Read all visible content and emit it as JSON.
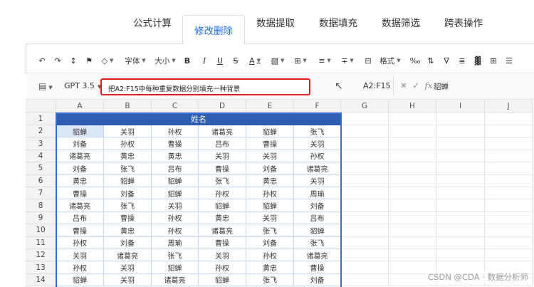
{
  "tabs": [
    "公式计算",
    "修改删除",
    "数据提取",
    "数据填充",
    "数据筛选",
    "跨表操作"
  ],
  "active_tab": 1,
  "toolbar": {
    "font_label": "字体",
    "size_label": "大小",
    "bold": "B",
    "italic": "I",
    "underline": "U",
    "strike": "S",
    "font_color": "A",
    "format_label": "格式"
  },
  "formula_bar": {
    "model": "GPT 3.5",
    "prompt": "把A2:F15中每种重复数据分别填充一种背景",
    "name_box": "A2:F15",
    "fx_value": "貂蝉"
  },
  "grid": {
    "columns": [
      "A",
      "B",
      "C",
      "D",
      "E",
      "F",
      "G",
      "H",
      "I",
      "J"
    ],
    "rows": [
      "1",
      "2",
      "3",
      "4",
      "5",
      "6",
      "7",
      "8",
      "9",
      "10",
      "11",
      "12",
      "13",
      "14"
    ],
    "header_title": "姓名",
    "data": [
      [
        "貂蝉",
        "关羽",
        "孙权",
        "诸葛亮",
        "貂蝉",
        "张飞"
      ],
      [
        "刘备",
        "孙权",
        "曹操",
        "吕布",
        "曹操",
        "关羽"
      ],
      [
        "诸葛亮",
        "黄忠",
        "黄忠",
        "关羽",
        "关羽",
        "孙权"
      ],
      [
        "刘备",
        "张飞",
        "吕布",
        "曹操",
        "刘备",
        "诸葛亮"
      ],
      [
        "黄忠",
        "貂蝉",
        "貂蝉",
        "张飞",
        "黄忠",
        "关羽"
      ],
      [
        "曹操",
        "刘备",
        "貂蝉",
        "孙权",
        "孙权",
        "周瑜"
      ],
      [
        "诸葛亮",
        "张飞",
        "关羽",
        "貂蝉",
        "貂蝉",
        "刘备"
      ],
      [
        "吕布",
        "曹操",
        "孙权",
        "黄忠",
        "关羽",
        "吕布"
      ],
      [
        "曹操",
        "黄忠",
        "孙权",
        "诸葛亮",
        "张飞",
        "貂蝉"
      ],
      [
        "孙权",
        "刘备",
        "周瑜",
        "曹操",
        "刘备",
        "张飞"
      ],
      [
        "关羽",
        "诸葛亮",
        "张飞",
        "关羽",
        "孙权",
        "诸葛亮"
      ],
      [
        "孙权",
        "关羽",
        "貂蝉",
        "孙权",
        "黄忠",
        "曹操"
      ],
      [
        "貂蝉",
        "关羽",
        "诸葛亮",
        "貂蝉",
        "张飞",
        "刘备"
      ]
    ]
  },
  "watermark": "CSDN @CDA · 数据分析师",
  "colors": {
    "active_tab": "#1a6fe0",
    "header_fill": "#2f5fb3",
    "highlight": "#e02020",
    "selected_cell": "#dbe7f9"
  }
}
